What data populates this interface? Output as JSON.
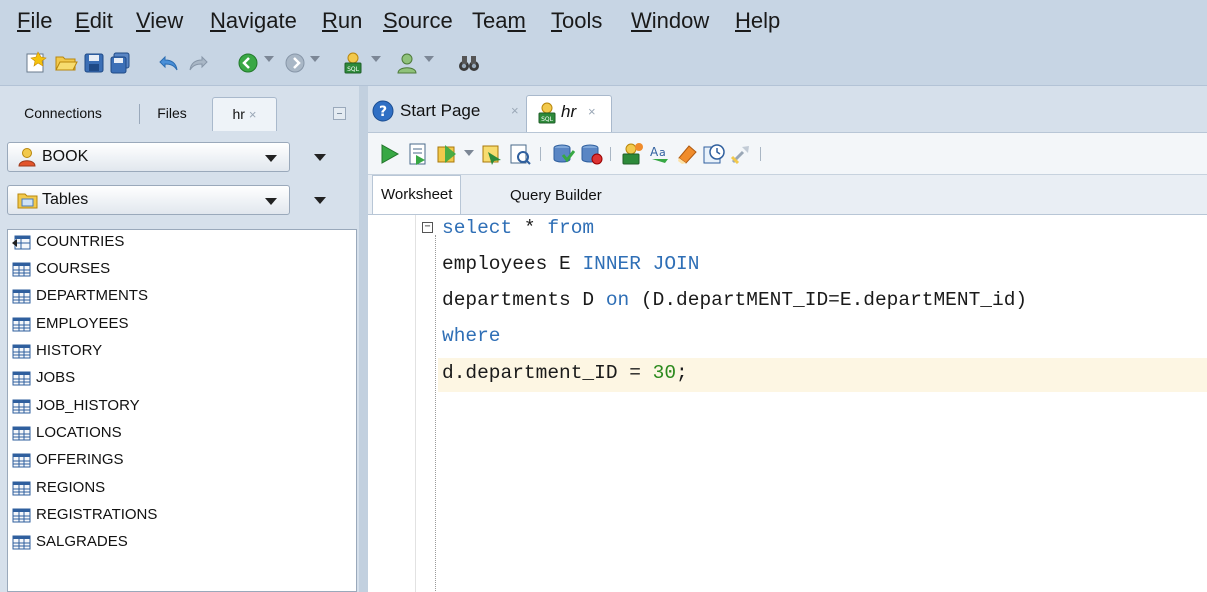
{
  "menubar": {
    "items": [
      {
        "u": "F",
        "rest": "ile"
      },
      {
        "u": "E",
        "rest": "dit"
      },
      {
        "u": "V",
        "rest": "iew"
      },
      {
        "u": "N",
        "rest": "avigate"
      },
      {
        "u": "R",
        "rest": "un"
      },
      {
        "u": "S",
        "rest": "ource"
      },
      {
        "pre": "Tea",
        "u": "m",
        "rest": ""
      },
      {
        "u": "T",
        "rest": "ools"
      },
      {
        "u": "W",
        "rest": "indow"
      },
      {
        "u": "H",
        "rest": "elp"
      }
    ]
  },
  "left_panel": {
    "tabs": {
      "connections": "Connections",
      "files": "Files",
      "hr": "hr"
    },
    "connection_combo": "BOOK",
    "object_type_combo": "Tables",
    "tables": [
      "COUNTRIES",
      "COURSES",
      "DEPARTMENTS",
      "EMPLOYEES",
      "HISTORY",
      "JOBS",
      "JOB_HISTORY",
      "LOCATIONS",
      "OFFERINGS",
      "REGIONS",
      "REGISTRATIONS",
      "SALGRADES"
    ]
  },
  "editor": {
    "tabs": {
      "start_page": "Start Page",
      "hr": "hr"
    },
    "subtabs": {
      "worksheet": "Worksheet",
      "query_builder": "Query Builder"
    },
    "code": {
      "line1_kw1": "select",
      "line1_star": " * ",
      "line1_kw2": "from",
      "line2_text": "employees E ",
      "line2_kw": "INNER JOIN",
      "line3_text1": "departments D ",
      "line3_kw": "on",
      "line3_text2": " (D.departMENT_ID=E.departMENT_id)",
      "line4_kw": "where",
      "line5_text": "d.department_ID = ",
      "line5_num": "30",
      "line5_end": ";"
    }
  },
  "colors": {
    "chrome": "#c7d5e4",
    "keyword": "#2f6fb6",
    "number": "#2c8a1e",
    "current_line": "#fdf6e3"
  }
}
